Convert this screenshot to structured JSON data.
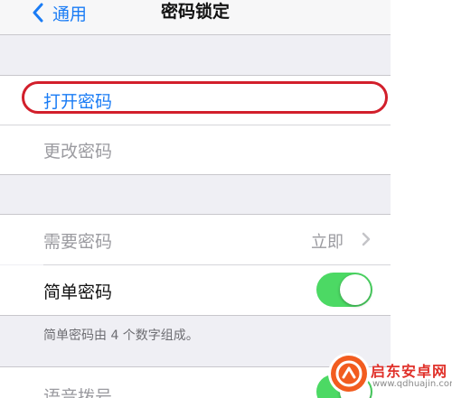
{
  "navbar": {
    "back_label": "通用",
    "title": "密码锁定"
  },
  "group1": {
    "turn_on_passcode": "打开密码",
    "change_passcode": "更改密码"
  },
  "group2": {
    "require_passcode": {
      "label": "需要密码",
      "value": "立即"
    },
    "simple_passcode": {
      "label": "简单密码",
      "enabled": true
    },
    "footnote": "简单密码由 4 个数字组成。",
    "voice_dial": {
      "label": "语音拨号"
    }
  },
  "watermark": {
    "name": "启东安卓网",
    "url": "www.qdhuajin.com"
  },
  "colors": {
    "accent": "#1a7cf5",
    "toggle_on": "#4cd964",
    "highlight": "#d21f2b",
    "logo": "#e0312a"
  }
}
